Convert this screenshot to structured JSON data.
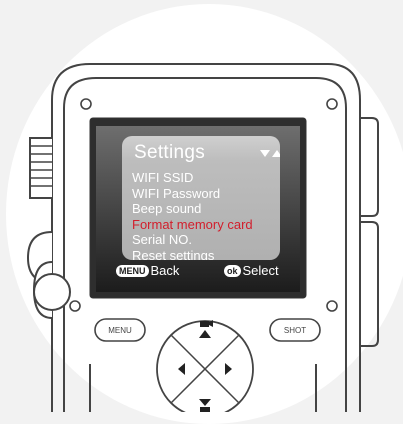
{
  "panel": {
    "title": "Settings",
    "sort_icon": "sort-triangles-icon",
    "items": [
      {
        "label": "WIFI SSID"
      },
      {
        "label": "WIFI Password"
      },
      {
        "label": "Beep sound"
      },
      {
        "label": "Format memory card",
        "selected": true
      },
      {
        "label": "Serial NO."
      },
      {
        "label": "Reset settings"
      }
    ]
  },
  "bottom_bar": {
    "menu_badge": "MENU",
    "back_label": "Back",
    "ok_badge": "ok",
    "select_label": "Select"
  },
  "buttons": {
    "menu": "MENU",
    "shot": "SHOT"
  },
  "colors": {
    "selected_item": "#d21e2c",
    "screen_bg": "#2a2a2a",
    "device_outline": "#444444"
  }
}
